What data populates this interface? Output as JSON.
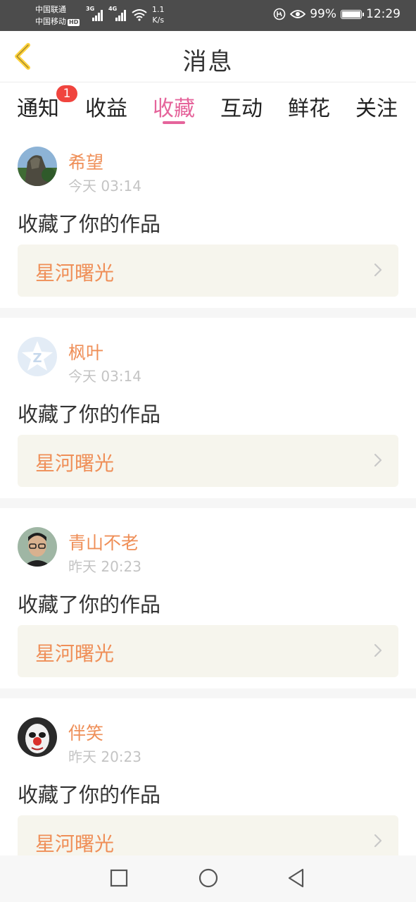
{
  "status_bar": {
    "carrier1": "中国联通",
    "carrier2": "中国移动",
    "hd": "HD",
    "net1": "3G",
    "net2": "4G",
    "speed_value": "1.1",
    "speed_unit": "K/s",
    "battery": "99%",
    "time": "12:29"
  },
  "header": {
    "title": "消息"
  },
  "tabs": [
    {
      "label": "通知",
      "badge": "1"
    },
    {
      "label": "收益"
    },
    {
      "label": "收藏",
      "active": true
    },
    {
      "label": "互动"
    },
    {
      "label": "鲜花"
    },
    {
      "label": "关注"
    }
  ],
  "messages": [
    {
      "name": "希望",
      "time": "今天 03:14",
      "action": "收藏了你的作品",
      "work": "星河曙光",
      "avatar": "landscape-avatar"
    },
    {
      "name": "枫叶",
      "time": "今天 03:14",
      "action": "收藏了你的作品",
      "work": "星河曙光",
      "avatar": "default-star-avatar"
    },
    {
      "name": "青山不老",
      "time": "昨天 20:23",
      "action": "收藏了你的作品",
      "work": "星河曙光",
      "avatar": "man-glasses-avatar"
    },
    {
      "name": "伴笑",
      "time": "昨天 20:23",
      "action": "收藏了你的作品",
      "work": "星河曙光",
      "avatar": "clown-face-avatar"
    }
  ],
  "colors": {
    "accent": "#e5649b",
    "name": "#ef8f58",
    "badge": "#f0443e",
    "status_bg": "#4c4c4c"
  }
}
